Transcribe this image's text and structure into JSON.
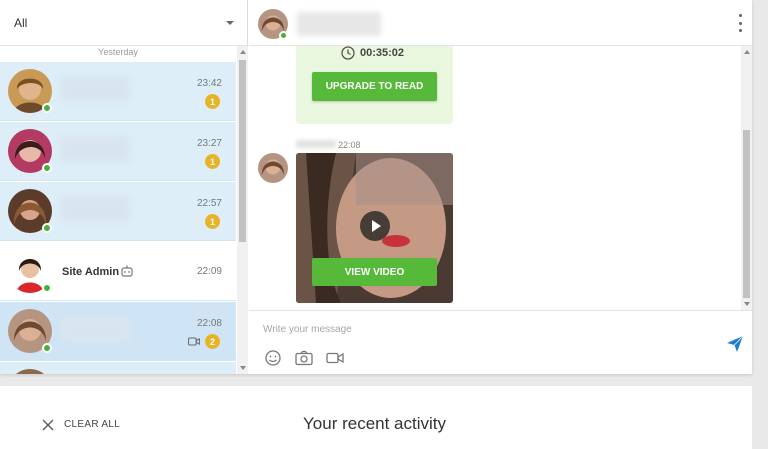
{
  "filter": {
    "label": "All"
  },
  "list": {
    "day_separator": "Yesterday",
    "conversations": [
      {
        "time": "23:42",
        "badge": "1",
        "online": true
      },
      {
        "time": "23:27",
        "badge": "1",
        "online": true
      },
      {
        "time": "22:57",
        "badge": "1",
        "online": true
      },
      {
        "name": "Site Admin",
        "time": "22:09",
        "online": true
      },
      {
        "time": "22:08",
        "badge": "2",
        "online": true
      }
    ]
  },
  "messages": {
    "locked": {
      "timer": "00:35:02",
      "button_label": "UPGRADE TO READ"
    },
    "video": {
      "time": "22:08",
      "button_label": "VIEW VIDEO"
    }
  },
  "composer": {
    "placeholder": "Write your message"
  },
  "bottom": {
    "clear_label": "CLEAR ALL",
    "title": "Your recent activity"
  },
  "colors": {
    "accent_green": "#56b93a",
    "badge": "#e8b427",
    "unread_bg": "#ddeef9",
    "send_blue": "#1e7bd2"
  },
  "icons": [
    "chevron-down-icon",
    "kebab-menu-icon",
    "clock-icon",
    "play-icon",
    "emoji-icon",
    "camera-icon",
    "video-camera-icon",
    "send-icon",
    "close-icon",
    "bot-icon"
  ]
}
